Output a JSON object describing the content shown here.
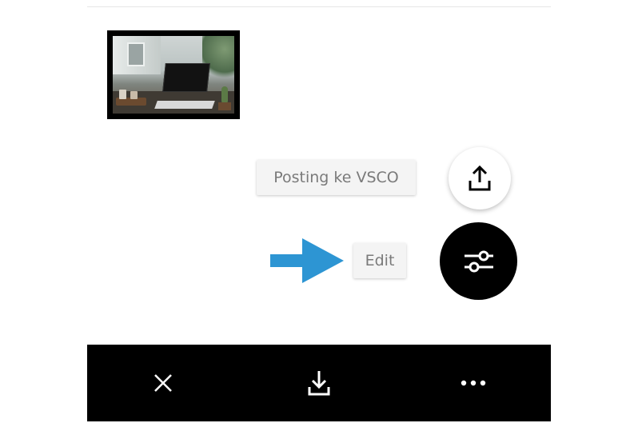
{
  "thumbnail": {
    "alt": "laptop on table photo"
  },
  "actions": {
    "share": {
      "label": "Posting ke VSCO",
      "icon": "upload-icon"
    },
    "edit": {
      "label": "Edit",
      "icon": "sliders-icon"
    }
  },
  "annotation": {
    "icon": "arrow-right-icon",
    "color": "#2d95d3"
  },
  "bottom_bar": {
    "buttons": [
      {
        "icon": "close-icon"
      },
      {
        "icon": "download-icon"
      },
      {
        "icon": "more-icon"
      }
    ]
  },
  "colors": {
    "background": "#ffffff",
    "bar": "#000000",
    "chip_text": "#7a7a7a",
    "arrow": "#2d95d3"
  }
}
